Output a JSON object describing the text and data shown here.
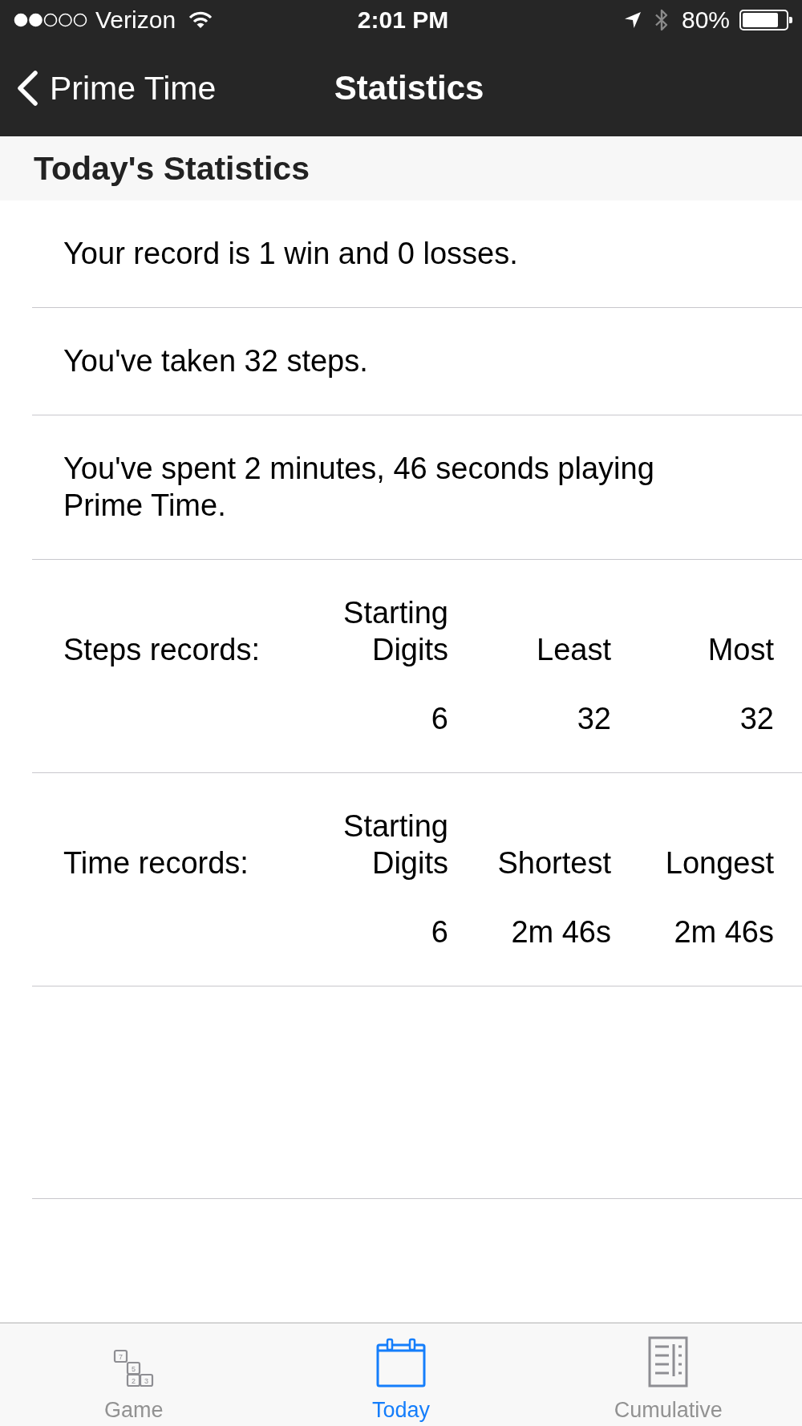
{
  "status_bar": {
    "carrier": "Verizon",
    "time": "2:01 PM",
    "battery": "80%"
  },
  "nav_bar": {
    "back_label": "Prime Time",
    "title": "Statistics"
  },
  "section_header": "Today's Statistics",
  "rows": [
    {
      "kind": "text",
      "text": "Your record is 1 win and 0 losses."
    },
    {
      "kind": "text",
      "text": "You've taken 32 steps."
    },
    {
      "kind": "text",
      "text": "You've spent 2 minutes, 46 seconds playing Prime Time."
    },
    {
      "kind": "records",
      "label": "Steps records:",
      "columns": [
        {
          "header": "Starting Digits",
          "value": "6"
        },
        {
          "header": "Least",
          "value": "32"
        },
        {
          "header": "Most",
          "value": "32"
        }
      ]
    },
    {
      "kind": "records",
      "label": "Time records:",
      "columns": [
        {
          "header": "Starting Digits",
          "value": "6"
        },
        {
          "header": "Shortest",
          "value": "2m 46s"
        },
        {
          "header": "Longest",
          "value": "2m 46s"
        }
      ]
    }
  ],
  "tab_bar": [
    {
      "kind": "game",
      "label": "Game",
      "selected": false,
      "tile_digits": [
        "7",
        "5",
        "2",
        "3"
      ]
    },
    {
      "kind": "calendar",
      "label": "Today",
      "selected": true
    },
    {
      "kind": "list",
      "label": "Cumulative",
      "selected": false
    }
  ]
}
